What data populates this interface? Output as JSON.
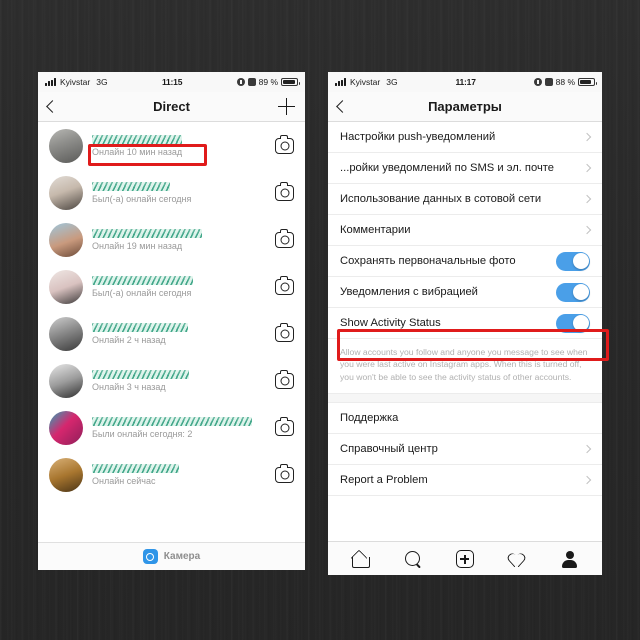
{
  "background_color": "#2b2b2b",
  "accent_color": "#4a9fe8",
  "annotation_color": "#e01b1b",
  "redaction_color": "#2f9e7e",
  "left_phone": {
    "status_bar": {
      "carrier": "Kyivstar",
      "network": "3G",
      "time": "11:15",
      "battery_percent": "89 %",
      "location_icon": "location-arrow-icon",
      "alarm_icon": "alarm-clock-icon",
      "signal_icon": "signal-bars-icon",
      "battery_icon": "battery-icon"
    },
    "nav": {
      "back_icon": "chevron-left-icon",
      "title": "Direct",
      "new_message_icon": "plus-icon"
    },
    "conversations": [
      {
        "username_redacted": true,
        "status": "Онлайн 10 мин назад",
        "camera_icon": "camera-icon",
        "highlighted": true,
        "redact_width": "52%"
      },
      {
        "username_redacted": true,
        "status": "Был(-а) онлайн сегодня",
        "camera_icon": "camera-icon",
        "highlighted": false,
        "redact_width": "45%"
      },
      {
        "username_redacted": true,
        "status": "Онлайн 19 мин назад",
        "camera_icon": "camera-icon",
        "highlighted": false,
        "redact_width": "63%"
      },
      {
        "username_redacted": true,
        "status": "Был(-а) онлайн сегодня",
        "camera_icon": "camera-icon",
        "highlighted": false,
        "redact_width": "58%"
      },
      {
        "username_redacted": true,
        "status": "Онлайн 2 ч назад",
        "camera_icon": "camera-icon",
        "highlighted": false,
        "redact_width": "55%"
      },
      {
        "username_redacted": true,
        "status": "Онлайн 3 ч назад",
        "camera_icon": "camera-icon",
        "highlighted": false,
        "redact_width": "56%"
      },
      {
        "username_redacted": true,
        "status": "Были онлайн сегодня: 2",
        "camera_icon": "camera-icon",
        "highlighted": false,
        "redact_width": "92%"
      },
      {
        "username_redacted": true,
        "status": "Онлайн сейчас",
        "camera_icon": "camera-icon",
        "highlighted": false,
        "redact_width": "50%"
      }
    ],
    "footer": {
      "camera_icon": "camera-badge-icon",
      "label": "Камера"
    }
  },
  "right_phone": {
    "status_bar": {
      "carrier": "Kyivstar",
      "network": "3G",
      "time": "11:17",
      "battery_percent": "88 %",
      "location_icon": "location-arrow-icon",
      "alarm_icon": "alarm-clock-icon",
      "signal_icon": "signal-bars-icon",
      "battery_icon": "battery-icon"
    },
    "nav": {
      "back_icon": "chevron-left-icon",
      "title": "Параметры"
    },
    "settings": [
      {
        "label": "Настройки push-уведомлений",
        "control": "chevron",
        "chevron_icon": "chevron-right-icon"
      },
      {
        "label": "...ройки уведомлений по SMS и эл. почте",
        "control": "chevron",
        "chevron_icon": "chevron-right-icon"
      },
      {
        "label": "Использование данных в сотовой сети",
        "control": "chevron",
        "chevron_icon": "chevron-right-icon"
      },
      {
        "label": "Комментарии",
        "control": "chevron",
        "chevron_icon": "chevron-right-icon"
      },
      {
        "label": "Сохранять первоначальные фото",
        "control": "toggle",
        "toggle_on": true
      },
      {
        "label": "Уведомления с вибрацией",
        "control": "toggle",
        "toggle_on": true
      },
      {
        "label": "Show Activity Status",
        "control": "toggle",
        "toggle_on": true,
        "highlighted": true
      }
    ],
    "activity_description": "Allow accounts you follow and anyone you message to see when you were last active on Instagram apps. When this is turned off, you won't be able to see the activity status of other accounts.",
    "settings_bottom": [
      {
        "label": "Поддержка",
        "control": "none"
      },
      {
        "label": "Справочный центр",
        "control": "chevron",
        "chevron_icon": "chevron-right-icon"
      },
      {
        "label": "Report a Problem",
        "control": "chevron",
        "chevron_icon": "chevron-right-icon"
      }
    ],
    "tabbar": [
      {
        "icon": "home-icon",
        "name": "tab-home"
      },
      {
        "icon": "search-icon",
        "name": "tab-search"
      },
      {
        "icon": "add-post-icon",
        "name": "tab-add"
      },
      {
        "icon": "heart-icon",
        "name": "tab-activity"
      },
      {
        "icon": "profile-icon",
        "name": "tab-profile"
      }
    ]
  }
}
